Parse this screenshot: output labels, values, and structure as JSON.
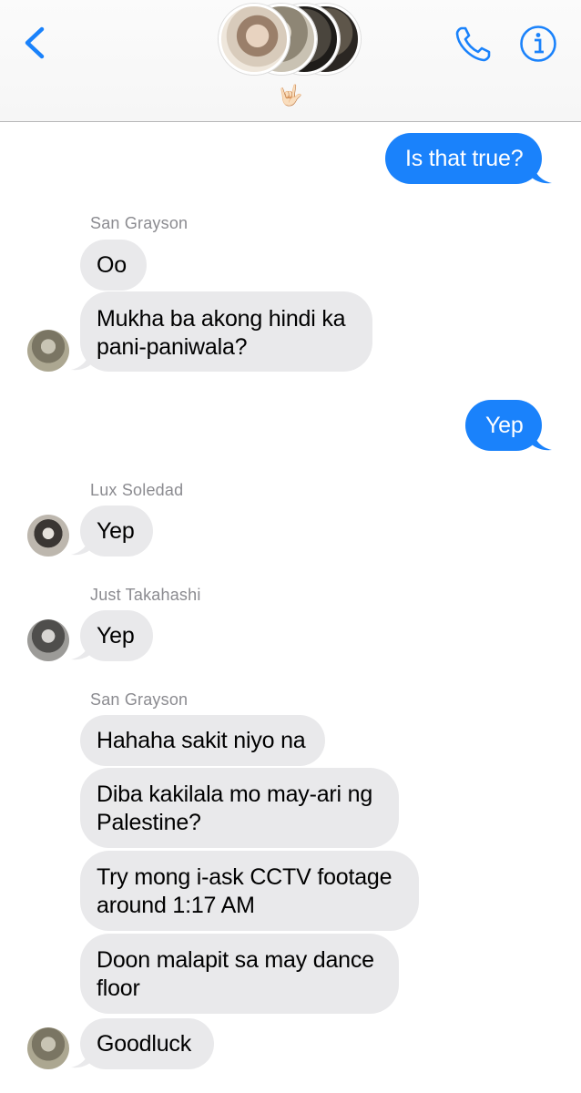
{
  "header": {
    "back_icon": "chevron-left-icon",
    "call_icon": "phone-icon",
    "info_icon": "info-icon",
    "group_emoji": "🤟🏻",
    "accent_color": "#1a82fb"
  },
  "colors": {
    "sent_bubble": "#1a82fb",
    "received_bubble": "#e9e9eb",
    "sender_name": "#8b8b90"
  },
  "messages": [
    {
      "from": "me",
      "text": "Is that true?"
    },
    {
      "from": "San Grayson",
      "sender_label": "San Grayson",
      "text": "Oo"
    },
    {
      "from": "San Grayson",
      "text_lines": [
        "Mukha ba akong hindi ka",
        "pani-paniwala?"
      ]
    },
    {
      "from": "me",
      "text": "Yep"
    },
    {
      "from": "Lux Soledad",
      "sender_label": "Lux Soledad",
      "text": "Yep"
    },
    {
      "from": "Just Takahashi",
      "sender_label": "Just Takahashi",
      "text": "Yep"
    },
    {
      "from": "San Grayson",
      "sender_label": "San Grayson",
      "text": "Hahaha sakit niyo na"
    },
    {
      "from": "San Grayson",
      "text_lines": [
        "Diba kakilala mo may-ari ng",
        "Palestine?"
      ]
    },
    {
      "from": "San Grayson",
      "text_lines": [
        "Try mong i-ask CCTV footage",
        "around 1:17 AM"
      ]
    },
    {
      "from": "San Grayson",
      "text_lines": [
        "Doon malapit sa may dance",
        "floor"
      ]
    },
    {
      "from": "San Grayson",
      "text": "Goodluck"
    }
  ]
}
